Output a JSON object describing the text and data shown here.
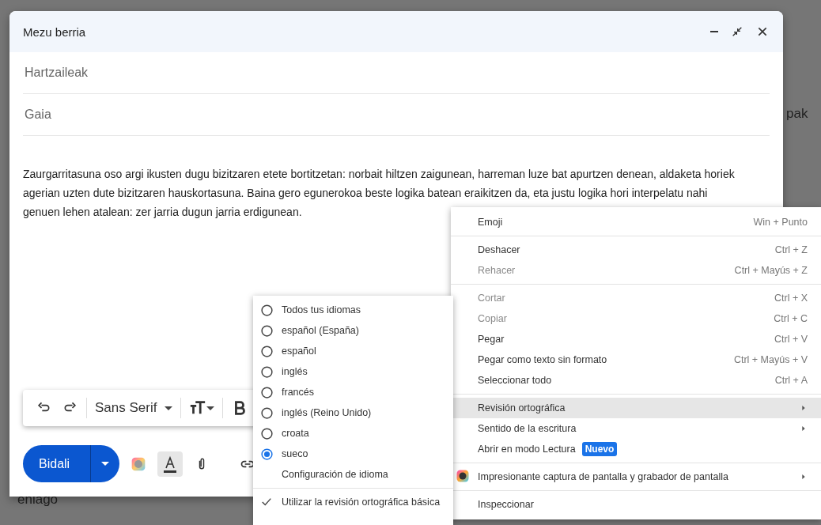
{
  "background": {
    "texts": [
      "pak",
      "eniago"
    ]
  },
  "compose": {
    "title": "Mezu berria",
    "fields": [
      {
        "placeholder": "Hartzaileak"
      },
      {
        "placeholder": "Gaia"
      }
    ],
    "body": "Zaurgarritasuna oso argi ikusten dugu bizitzaren etete bortitzetan: norbait hiltzen zaigunean, harreman luze bat apurtzen denean, aldaketa horiek agerian uzten dute bizitzaren hauskortasuna. Baina gero egunerokoa beste logika batean eraikitzen da, eta justu logika hori interpelatu nahi genuen lehen atalean: zer jarria dugun jarria erdigunean.",
    "toolbar": {
      "font": "Sans Serif"
    },
    "send_button": "Bidali"
  },
  "context_menu": {
    "items": [
      {
        "kind": "item",
        "label": "Emoji",
        "shortcut": "Win + Punto",
        "disabled": false,
        "highlighted": false
      },
      {
        "kind": "separator"
      },
      {
        "kind": "item",
        "label": "Deshacer",
        "shortcut": "Ctrl + Z",
        "disabled": false,
        "highlighted": false
      },
      {
        "kind": "item",
        "label": "Rehacer",
        "shortcut": "Ctrl + Mayús + Z",
        "disabled": true,
        "highlighted": false
      },
      {
        "kind": "separator"
      },
      {
        "kind": "item",
        "label": "Cortar",
        "shortcut": "Ctrl + X",
        "disabled": true,
        "highlighted": false
      },
      {
        "kind": "item",
        "label": "Copiar",
        "shortcut": "Ctrl + C",
        "disabled": true,
        "highlighted": false
      },
      {
        "kind": "item",
        "label": "Pegar",
        "shortcut": "Ctrl + V",
        "disabled": false,
        "highlighted": false
      },
      {
        "kind": "item",
        "label": "Pegar como texto sin formato",
        "shortcut": "Ctrl + Mayús + V",
        "disabled": false,
        "highlighted": false
      },
      {
        "kind": "item",
        "label": "Seleccionar todo",
        "shortcut": "Ctrl + A",
        "disabled": false,
        "highlighted": false
      },
      {
        "kind": "separator"
      },
      {
        "kind": "submenu",
        "label": "Revisión ortográfica",
        "disabled": false,
        "highlighted": true
      },
      {
        "kind": "submenu",
        "label": "Sentido de la escritura",
        "disabled": false,
        "highlighted": false
      },
      {
        "kind": "item",
        "label": "Abrir en modo Lectura",
        "badge": "Nuevo",
        "disabled": false,
        "highlighted": false
      },
      {
        "kind": "separator"
      },
      {
        "kind": "extension",
        "label": "Impresionante captura de pantalla y grabador de pantalla",
        "disabled": false,
        "highlighted": false
      },
      {
        "kind": "separator"
      },
      {
        "kind": "item",
        "label": "Inspeccionar",
        "disabled": false,
        "highlighted": false
      }
    ]
  },
  "spell_submenu": {
    "items": [
      {
        "kind": "radio",
        "label": "Todos tus idiomas",
        "selected": false
      },
      {
        "kind": "radio",
        "label": "español (España)",
        "selected": false
      },
      {
        "kind": "radio",
        "label": "español",
        "selected": false
      },
      {
        "kind": "radio",
        "label": "inglés",
        "selected": false
      },
      {
        "kind": "radio",
        "label": "francés",
        "selected": false
      },
      {
        "kind": "radio",
        "label": "inglés (Reino Unido)",
        "selected": false
      },
      {
        "kind": "radio",
        "label": "croata",
        "selected": false
      },
      {
        "kind": "radio",
        "label": "sueco",
        "selected": true
      },
      {
        "kind": "item",
        "label": "Configuración de idioma"
      },
      {
        "kind": "separator"
      },
      {
        "kind": "check",
        "label": "Utilizar la revisión ortográfica básica",
        "checked": true
      }
    ]
  }
}
